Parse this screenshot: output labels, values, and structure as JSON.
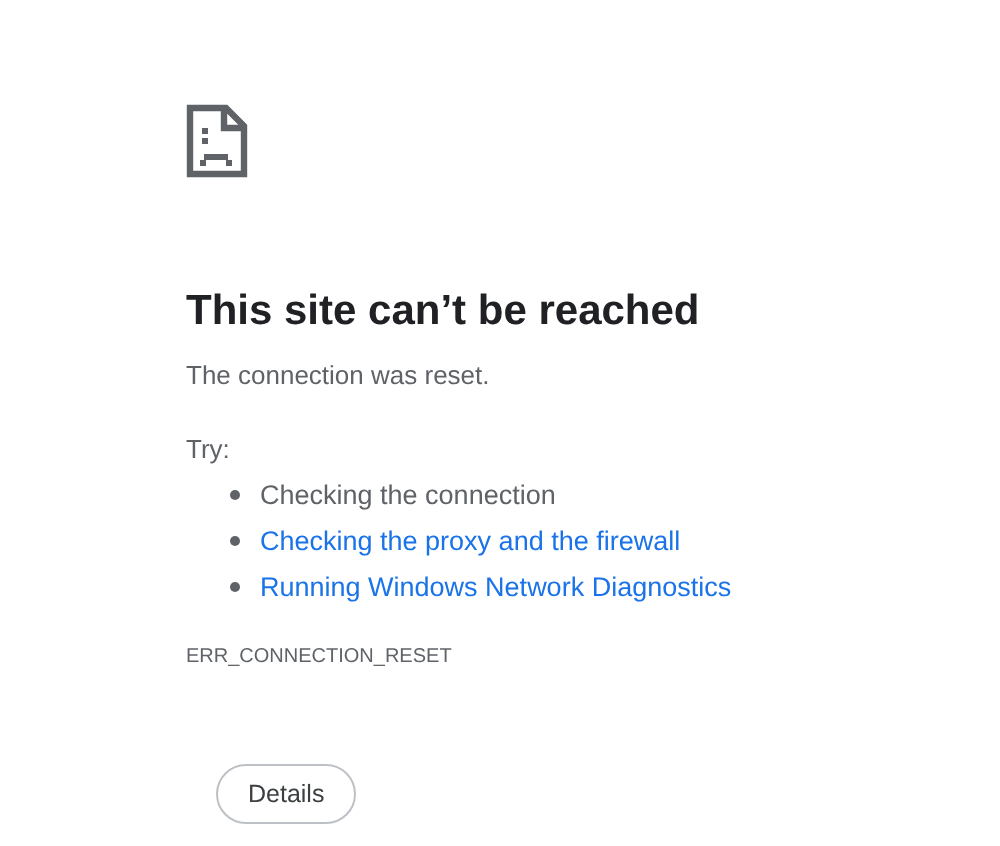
{
  "heading": "This site can’t be reached",
  "message": "The connection was reset.",
  "try_label": "Try:",
  "suggestions": [
    {
      "kind": "text",
      "text": "Checking the connection"
    },
    {
      "kind": "link",
      "text": "Checking the proxy and the firewall"
    },
    {
      "kind": "link",
      "text": "Running Windows Network Diagnostics"
    }
  ],
  "error_code": "ERR_CONNECTION_RESET",
  "buttons": [
    "Details"
  ]
}
